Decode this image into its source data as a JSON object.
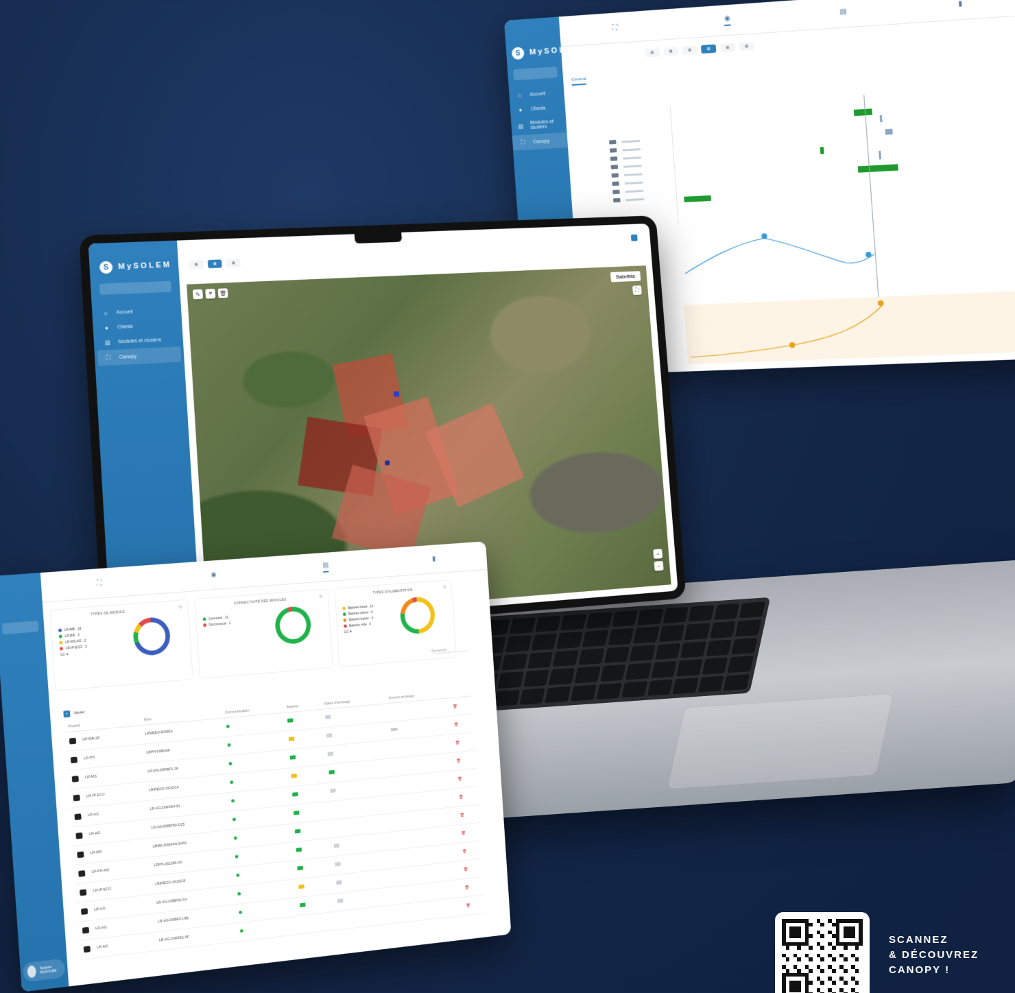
{
  "brand": {
    "name": "MySOLEM",
    "logo_glyph": "S"
  },
  "colors": {
    "background": "#14284a",
    "sidebar": "#2f80bd",
    "accent": "#2f80bd",
    "green": "#1e9a2e",
    "red": "#e14a4a",
    "yellow": "#f0c21b"
  },
  "planning": {
    "sidebar": {
      "items": [
        {
          "label": "Accueil",
          "icon": "home-icon"
        },
        {
          "label": "Clients",
          "icon": "user-icon"
        },
        {
          "label": "Modules et clusters",
          "icon": "modules-icon"
        },
        {
          "label": "Canopy",
          "icon": "canopy-icon"
        }
      ]
    },
    "tabs": [
      "Général"
    ]
  },
  "laptop": {
    "sidebar": {
      "items": [
        {
          "label": "Accueil",
          "icon": "home-icon"
        },
        {
          "label": "Clients",
          "icon": "user-icon"
        },
        {
          "label": "Modules et clusters",
          "icon": "modules-icon"
        },
        {
          "label": "Canopy",
          "icon": "canopy-icon"
        }
      ]
    },
    "map": {
      "layer": "Satellite"
    }
  },
  "modules": {
    "cards": [
      {
        "title": "TYPES DE MODULE",
        "legend": [
          {
            "label": "LR-MB : 18",
            "color": "#3b5fc0"
          },
          {
            "label": "LR-BB : 3",
            "color": "#1fb34a"
          },
          {
            "label": "LR-MS-AG : 2",
            "color": "#f0c21b"
          },
          {
            "label": "LR-IP ECO : 3",
            "color": "#e14a4a"
          },
          {
            "label": "1/2 ▼",
            "color": ""
          }
        ]
      },
      {
        "title": "CONNECTIVITÉ DES MODULES",
        "legend": [
          {
            "label": "Connecté : 21",
            "color": "#1fb34a"
          },
          {
            "label": "Déconnecté : 1",
            "color": "#e14a4a"
          }
        ]
      },
      {
        "title": "TYPES D'ALIMENTATION",
        "legend": [
          {
            "label": "Batterie haute : 11",
            "color": "#f0c21b"
          },
          {
            "label": "Batterie pleine : 6",
            "color": "#1fb34a"
          },
          {
            "label": "Batterie basse : 4",
            "color": "#f08a1b"
          },
          {
            "label": "Batterie vide : 0",
            "color": "#e14a4a"
          },
          {
            "label": "1/2 ▼",
            "color": ""
          }
        ]
      }
    ],
    "add_label": "Ajouter",
    "search_placeholder": "Recherche...",
    "columns": [
      "Produit",
      "Nom",
      "Communication",
      "Batterie",
      "Statut d'arrosage",
      "Dernier arrosage"
    ],
    "rows": [
      {
        "product": "LR-MB-2R",
        "name": "LRMBDV-8G8RA",
        "battery_color": "#1fb34a",
        "water": "#cfd3d7",
        "last": ""
      },
      {
        "product": "LR-PH",
        "name": "LRPH-D9B40F",
        "battery_color": "#f0c21b",
        "water": "#cfd3d7",
        "last": "33%"
      },
      {
        "product": "LR-MS",
        "name": "LR-MS-D9FBF1-36",
        "battery_color": "#1fb34a",
        "water": "#cfd3d7",
        "last": ""
      },
      {
        "product": "LR-IP ECO",
        "name": "LRIPECO-061DC4",
        "battery_color": "#f0c21b",
        "water": "#1fb34a",
        "last": ""
      },
      {
        "product": "LR-AG",
        "name": "LR-AG-D9FA54-91",
        "battery_color": "#1fb34a",
        "water": "#cfd3d7",
        "last": ""
      },
      {
        "product": "LR-AG",
        "name": "LR-AG-D9BFB0-D25",
        "battery_color": "#1fb34a",
        "water": "",
        "last": ""
      },
      {
        "product": "LR-MS",
        "name": "LRMS-D9EFFA-D451",
        "battery_color": "#1fb34a",
        "water": "",
        "last": ""
      },
      {
        "product": "LR-PH-AG",
        "name": "LRPH-062189-DF",
        "battery_color": "#1fb34a",
        "water": "#cfd3d7",
        "last": ""
      },
      {
        "product": "LR-IP ECO",
        "name": "LRIPECO-0A2DC6",
        "battery_color": "#1fb34a",
        "water": "#cfd3d7",
        "last": ""
      },
      {
        "product": "LR-AG",
        "name": "LR-AG-D9BF61-54",
        "battery_color": "#f0c21b",
        "water": "#cfd3d7",
        "last": ""
      },
      {
        "product": "LR-AG",
        "name": "LR-AG-D9BFF1-8E",
        "battery_color": "#1fb34a",
        "water": "#cfd3d7",
        "last": ""
      },
      {
        "product": "LR-AG",
        "name": "LR-AG-D9FF61-5F",
        "battery_color": "",
        "water": "",
        "last": ""
      }
    ],
    "support": {
      "name": "Support MySOLEM"
    }
  },
  "qr": {
    "caption_lines": [
      "SCANNEZ",
      "& DÉCOUVREZ",
      "CANOPY !"
    ]
  }
}
